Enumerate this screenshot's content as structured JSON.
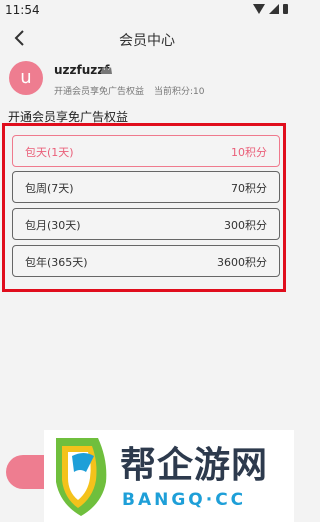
{
  "status_bar": {
    "time": "11:54"
  },
  "nav": {
    "title": "会员中心"
  },
  "profile": {
    "avatar_letter": "u",
    "username": "uzzfuzzf",
    "subtitle": "开通会员享免广告权益",
    "points": "当前积分:10"
  },
  "section_title": "开通会员享免广告权益",
  "plans": [
    {
      "name": "包天(1天)",
      "price": "10积分",
      "selected": true
    },
    {
      "name": "包周(7天)",
      "price": "70积分",
      "selected": false
    },
    {
      "name": "包月(30天)",
      "price": "300积分",
      "selected": false
    },
    {
      "name": "包年(365天)",
      "price": "3600积分",
      "selected": false
    }
  ],
  "watermark": {
    "cn": "帮企游网",
    "en": "BANGQ·CC"
  },
  "colors": {
    "accent": "#ee7d90",
    "highlight": "#e00d1c",
    "background": "#f3f3f3"
  }
}
